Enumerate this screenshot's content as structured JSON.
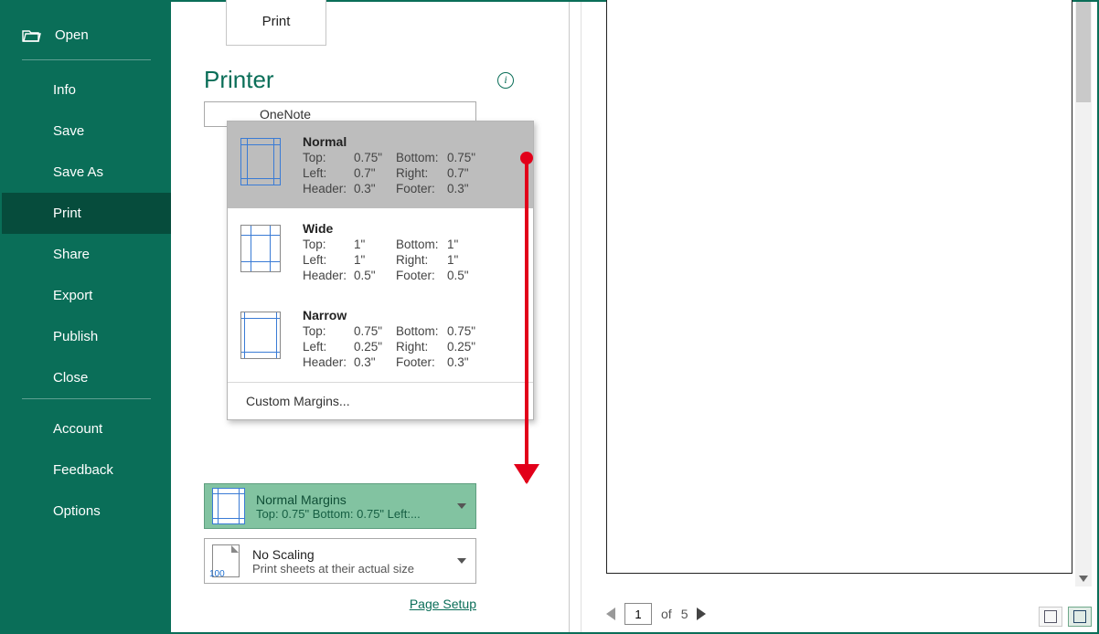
{
  "sidebar": {
    "open": "Open",
    "items": [
      "Info",
      "Save",
      "Save As",
      "Print",
      "Share",
      "Export",
      "Publish",
      "Close"
    ],
    "active_index": 3,
    "footer": [
      "Account",
      "Feedback",
      "Options"
    ]
  },
  "print_tab": "Print",
  "printer": {
    "heading": "Printer",
    "name": "OneNote"
  },
  "margin_options": [
    {
      "title": "Normal",
      "top": "0.75\"",
      "bottom": "0.75\"",
      "left": "0.7\"",
      "right": "0.7\"",
      "header": "0.3\"",
      "footer": "0.3\""
    },
    {
      "title": "Wide",
      "top": "1\"",
      "bottom": "1\"",
      "left": "1\"",
      "right": "1\"",
      "header": "0.5\"",
      "footer": "0.5\""
    },
    {
      "title": "Narrow",
      "top": "0.75\"",
      "bottom": "0.75\"",
      "left": "0.25\"",
      "right": "0.25\"",
      "header": "0.3\"",
      "footer": "0.3\""
    }
  ],
  "margin_labels": {
    "top": "Top:",
    "bottom": "Bottom:",
    "left": "Left:",
    "right": "Right:",
    "header": "Header:",
    "footer": "Footer:"
  },
  "custom_margins": "Custom Margins...",
  "margins_dropdown": {
    "line1": "Normal Margins",
    "line2": "Top: 0.75\" Bottom: 0.75\" Left:..."
  },
  "scaling_dropdown": {
    "line1": "No Scaling",
    "line2": "Print sheets at their actual size",
    "badge": "100"
  },
  "page_setup": "Page Setup",
  "pager": {
    "current": "1",
    "of_label": "of",
    "total": "5"
  }
}
